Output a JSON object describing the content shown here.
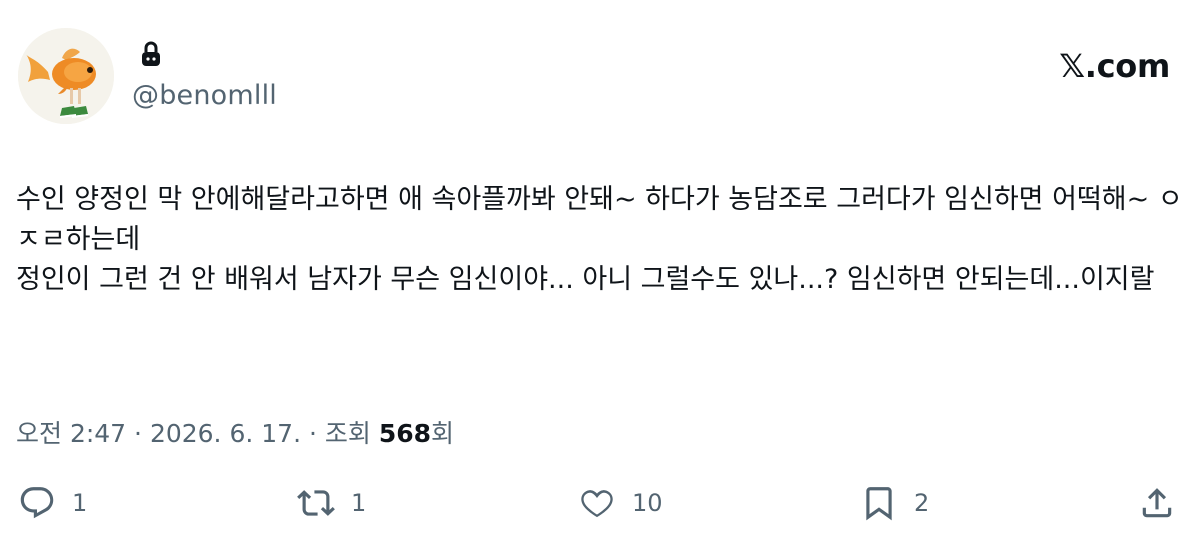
{
  "author": {
    "handle": "@benomlll",
    "protected": true
  },
  "brand": "𝕏.com",
  "tweet": {
    "text": "수인 양정인 막 안에해달라고하면 애 속아플까봐 안돼~ 하다가 농담조로 그러다가 임신하면 어떡해~ ㅇㅈㄹ하는데\n정인이 그런 건 안 배워서 남자가 무슨 임신이야... 아니 그럴수도 있나...? 임신하면 안되는데...이지랄"
  },
  "meta": {
    "time": "오전 2:47",
    "sep1": " · ",
    "date": "2026. 6. 17.",
    "sep2": " · ",
    "views_label": "조회 ",
    "views_count": "568",
    "views_suffix": "회"
  },
  "actions": {
    "reply_count": "1",
    "retweet_count": "1",
    "like_count": "10",
    "bookmark_count": "2"
  },
  "icons": [
    "lock-icon",
    "reply-icon",
    "retweet-icon",
    "like-icon",
    "bookmark-icon",
    "share-icon"
  ],
  "colors": {
    "text": "#0f1419",
    "secondary": "#536471",
    "background": "#ffffff"
  }
}
